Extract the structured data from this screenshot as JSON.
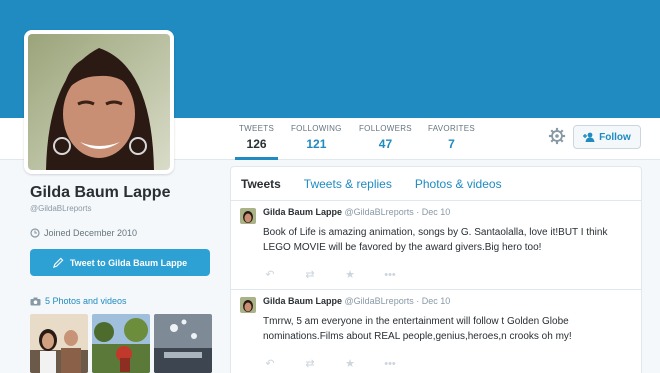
{
  "profile": {
    "name": "Gilda Baum Lappe",
    "handle": "@GildaBLreports",
    "joined": "Joined December 2010",
    "tweet_to_label": "Tweet to Gilda Baum Lappe",
    "photos_label": "5 Photos and videos"
  },
  "stats": [
    {
      "label": "TWEETS",
      "value": "126"
    },
    {
      "label": "FOLLOWING",
      "value": "121"
    },
    {
      "label": "FOLLOWERS",
      "value": "47"
    },
    {
      "label": "FAVORITES",
      "value": "7"
    }
  ],
  "follow_label": "Follow",
  "tabs": [
    "Tweets",
    "Tweets & replies",
    "Photos & videos"
  ],
  "tweets": [
    {
      "name": "Gilda Baum Lappe",
      "meta": "@GildaBLreports · Dec 10",
      "text": "Book of Life is amazing animation, songs by G. Santaolalla, love it!BUT I think LEGO MOVIE will be favored by the award givers.Big hero too!"
    },
    {
      "name": "Gilda Baum Lappe",
      "meta": "@GildaBLreports · Dec 10",
      "text": "Tmrrw, 5 am everyone in the entertainment will follow t Golden Globe nominations.Films about REAL people,genius,heroes,n crooks oh my!"
    }
  ],
  "colors": {
    "brand": "#1f8bc1",
    "banner": "#1f8bc1",
    "button": "#2ea1d4"
  },
  "icons": [
    "gear-icon",
    "add-user-icon",
    "calendar-clock-icon",
    "compose-icon",
    "camera-icon",
    "reply-icon",
    "retweet-icon",
    "favorite-icon",
    "more-icon"
  ]
}
